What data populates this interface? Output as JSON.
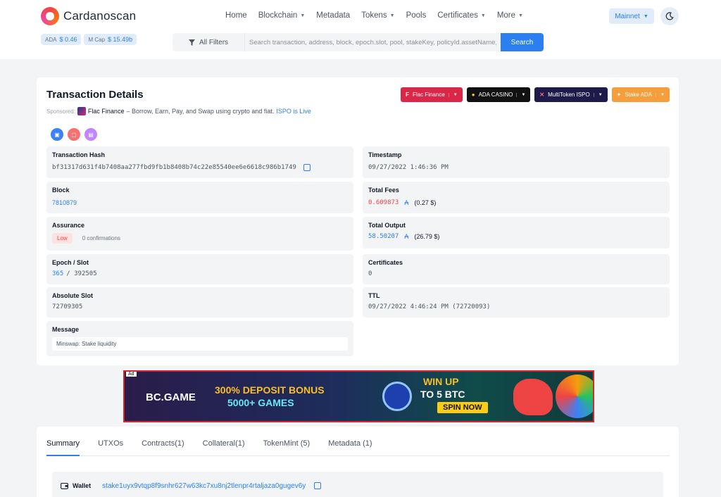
{
  "header": {
    "logo_text": "Cardanoscan",
    "prices": [
      {
        "label": "ADA",
        "value": "$ 0.46"
      },
      {
        "label": "M Cap",
        "value": "$ 15.49b"
      }
    ],
    "nav": [
      {
        "label": "Home",
        "has_dropdown": false
      },
      {
        "label": "Blockchain",
        "has_dropdown": true
      },
      {
        "label": "Metadata",
        "has_dropdown": false
      },
      {
        "label": "Tokens",
        "has_dropdown": true
      },
      {
        "label": "Pools",
        "has_dropdown": false
      },
      {
        "label": "Certificates",
        "has_dropdown": true
      },
      {
        "label": "More",
        "has_dropdown": true
      }
    ],
    "network": "Mainnet",
    "search": {
      "filter_label": "All Filters",
      "placeholder": "Search transaction, address, block, epoch.slot, pool, stakeKey, policyId.assetName,",
      "button": "Search"
    }
  },
  "tx": {
    "title": "Transaction Details",
    "sponsored": {
      "label": "Sponsored:",
      "brand": "Flac Finance",
      "text": "– Borrow, Earn, Pay, and Swap using crypto and fiat.",
      "link": "ISPO is Live"
    },
    "sponsor_buttons": [
      "Flac Finance",
      "ADA CASINO",
      "MultiToken ISPO",
      "Stake ADA"
    ],
    "fields": {
      "hash_label": "Transaction Hash",
      "hash": "bf31317d631f4b7408aa277fbd9fb1b8408b74c22e85540ee6e6618c986b1749",
      "timestamp_label": "Timestamp",
      "timestamp": "09/27/2022 1:46:36 PM",
      "block_label": "Block",
      "block": "7810879",
      "fees_label": "Total Fees",
      "fees": "0.609873",
      "fees_usd": "(0.27 $)",
      "assurance_label": "Assurance",
      "assurance": "Low",
      "confirmations": "0 confirmations",
      "output_label": "Total Output",
      "output": "58.50207",
      "output_usd": "(26.79 $)",
      "epoch_label": "Epoch / Slot",
      "epoch": "365",
      "slot": "/ 392505",
      "certs_label": "Certificates",
      "certs": "0",
      "abs_slot_label": "Absolute Slot",
      "abs_slot": "72709305",
      "ttl_label": "TTL",
      "ttl": "09/27/2022 4:46:24 PM (72720093)",
      "message_label": "Message",
      "message": "Minswap: Stake liquidity",
      "ada_symbol": "₳"
    }
  },
  "ad": {
    "tag": "Ad",
    "brand": "BC.GAME",
    "line1": "300% DEPOSIT BONUS",
    "line2": "5000+ GAMES",
    "win": "WIN UP",
    "btc": "TO 5 BTC",
    "spin": "SPIN NOW"
  },
  "tabs": [
    {
      "label": "Summary",
      "active": true
    },
    {
      "label": "UTXOs",
      "active": false
    },
    {
      "label": "Contracts(1)",
      "active": false
    },
    {
      "label": "Collateral(1)",
      "active": false
    },
    {
      "label": "TokenMint (5)",
      "active": false
    },
    {
      "label": "Metadata (1)",
      "active": false
    }
  ],
  "wallet": {
    "label": "Wallet",
    "value": "stake1uyx9vtqp8f9snhr627w63kc7xu8nj2tlenpr4rtaljaza0gugev6y"
  },
  "colors": {
    "accent": "#2b7ff0",
    "danger": "#ef4444",
    "page_bg": "#f3f4f6"
  }
}
